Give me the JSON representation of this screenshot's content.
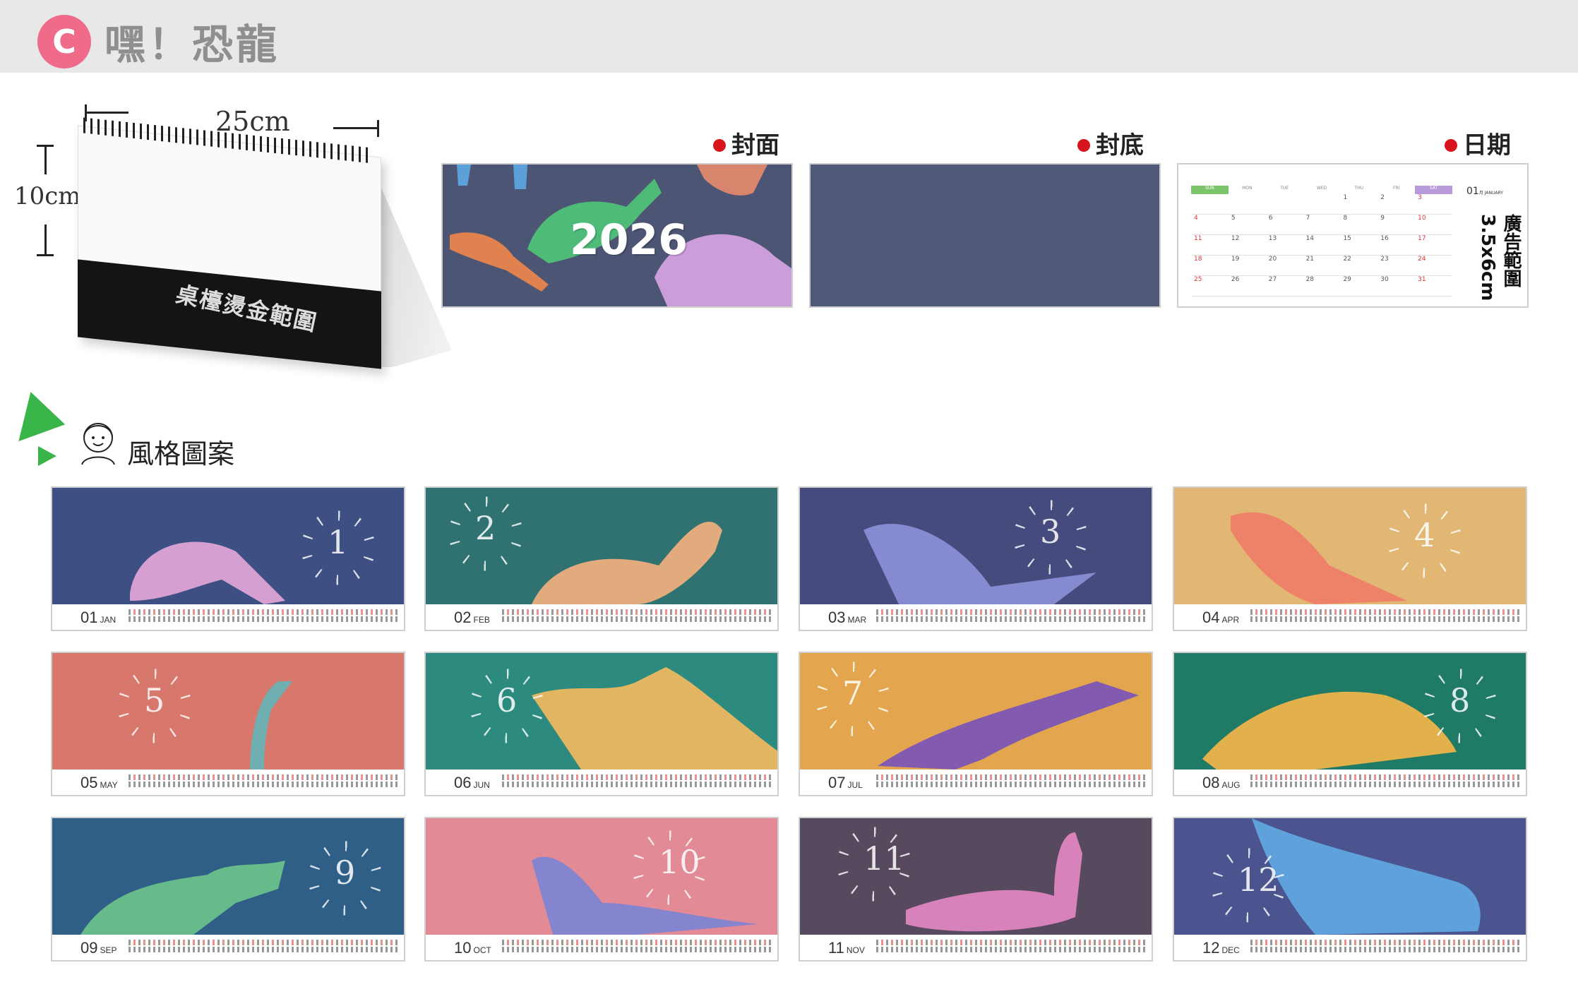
{
  "header": {
    "badge": "C",
    "title": "嘿！恐龍"
  },
  "size_diagram": {
    "width_label": "25cm",
    "height_label": "10cm",
    "foil_label": "桌檯燙金範圍"
  },
  "panels": {
    "cover": {
      "label": "封面",
      "year": "2026",
      "bg": "#4c5573"
    },
    "back": {
      "label": "封底",
      "bg": "#4f5876"
    },
    "date": {
      "label": "日期",
      "month_label": "01",
      "month_sub": "月 JANUARY",
      "ad_label": "廣告範圍",
      "ad_size": "3.5x6cm",
      "weekdays": [
        "SUN",
        "MON",
        "TUE",
        "WED",
        "THU",
        "FRI",
        "SAT"
      ],
      "weeks": [
        [
          "",
          "",
          "",
          "",
          "1",
          "2",
          "3"
        ],
        [
          "4",
          "5",
          "6",
          "7",
          "8",
          "9",
          "10"
        ],
        [
          "11",
          "12",
          "13",
          "14",
          "15",
          "16",
          "17"
        ],
        [
          "18",
          "19",
          "20",
          "21",
          "22",
          "23",
          "24"
        ],
        [
          "25",
          "26",
          "27",
          "28",
          "29",
          "30",
          "31"
        ]
      ]
    }
  },
  "style_section": {
    "title": "風格圖案"
  },
  "months": [
    {
      "num": "01",
      "abbr": "JAN",
      "bg": "#3e4f83",
      "dino": "#e2a6d8",
      "hand": "1"
    },
    {
      "num": "02",
      "abbr": "FEB",
      "bg": "#2f7271",
      "dino": "#f1b07e",
      "hand": "2"
    },
    {
      "num": "03",
      "abbr": "MAR",
      "bg": "#454b7c",
      "dino": "#8b8fd8",
      "hand": "3"
    },
    {
      "num": "04",
      "abbr": "APR",
      "bg": "#e2b774",
      "dino": "#ef7d68",
      "hand": "4"
    },
    {
      "num": "05",
      "abbr": "MAY",
      "bg": "#d8776c",
      "dino": "#66b4b8",
      "hand": "5"
    },
    {
      "num": "06",
      "abbr": "JUN",
      "bg": "#2c8a7e",
      "dino": "#f2b95f",
      "hand": "6"
    },
    {
      "num": "07",
      "abbr": "JUL",
      "bg": "#e3a54d",
      "dino": "#7a55b8",
      "hand": "7"
    },
    {
      "num": "08",
      "abbr": "AUG",
      "bg": "#1f7a66",
      "dino": "#f4b54a",
      "hand": "8"
    },
    {
      "num": "09",
      "abbr": "SEP",
      "bg": "#2f5f86",
      "dino": "#6cc28a",
      "hand": "9"
    },
    {
      "num": "10",
      "abbr": "OCT",
      "bg": "#e28a96",
      "dino": "#7c84d2",
      "hand": "10"
    },
    {
      "num": "11",
      "abbr": "NOV",
      "bg": "#584a5e",
      "dino": "#e287c2",
      "hand": "11"
    },
    {
      "num": "12",
      "abbr": "DEC",
      "bg": "#4b548e",
      "dino": "#5fa8e2",
      "hand": "12"
    }
  ]
}
